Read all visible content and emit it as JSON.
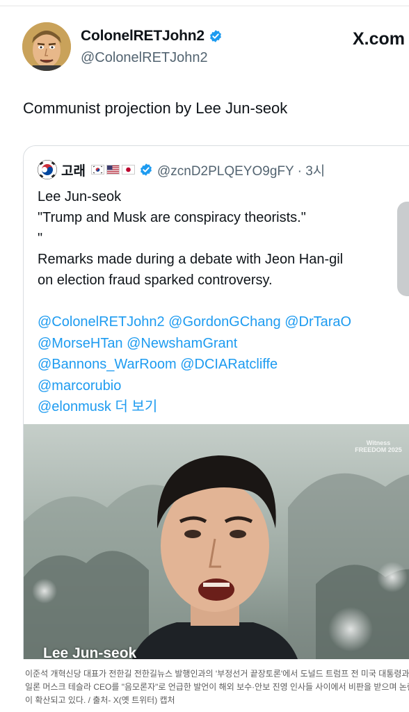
{
  "header": {
    "display_name": "ColonelRETJohn2",
    "handle": "@ColonelRETJohn2",
    "site": "X.com",
    "verified_icon": "verified-badge-icon",
    "verified_color": "#1d9bf0"
  },
  "tweet": {
    "text": "Communist projection by Lee Jun-seok"
  },
  "quote": {
    "display_name": "고래",
    "flags": [
      "kr-flag-icon",
      "us-flag-icon",
      "jp-flag-icon"
    ],
    "handle_time": "@zcnD2PLQEYO9gFY · 3시",
    "lines": [
      "Lee Jun-seok",
      "\"Trump and Musk are conspiracy theorists.\"",
      "\"",
      "Remarks made during a debate with Jeon Han-gil",
      "on election fraud sparked controversy."
    ],
    "mention_lines": [
      "@ColonelRETJohn2 @GordonGChang @DrTaraO",
      "@MorseHTan @NewshamGrant",
      "@Bannons_WarRoom  @DCIARatcliffe",
      "@marcorubio"
    ],
    "last_mention": "@elonmusk",
    "more_label": " 더 보기",
    "media_caption": "Lee Jun-seok",
    "media_watermark": "Witness FREEDOM 2025",
    "link_color": "#1d9bf0"
  },
  "news_caption": {
    "lines": [
      "이준석 개혁신당 대표가 전한길 전한길뉴스 발행인과의 '부정선거 끝장토론'에서 도널드 트럼프 전 미국 대통령과",
      "일론 머스크 테슬라 CEO를 \"음모론자\"로 언급한 발언이 해외 보수·안보 진영 인사들 사이에서 비판을 받으며 논란",
      "이 확산되고 있다. / 출처- X(옛 트위터) 캡처"
    ]
  }
}
